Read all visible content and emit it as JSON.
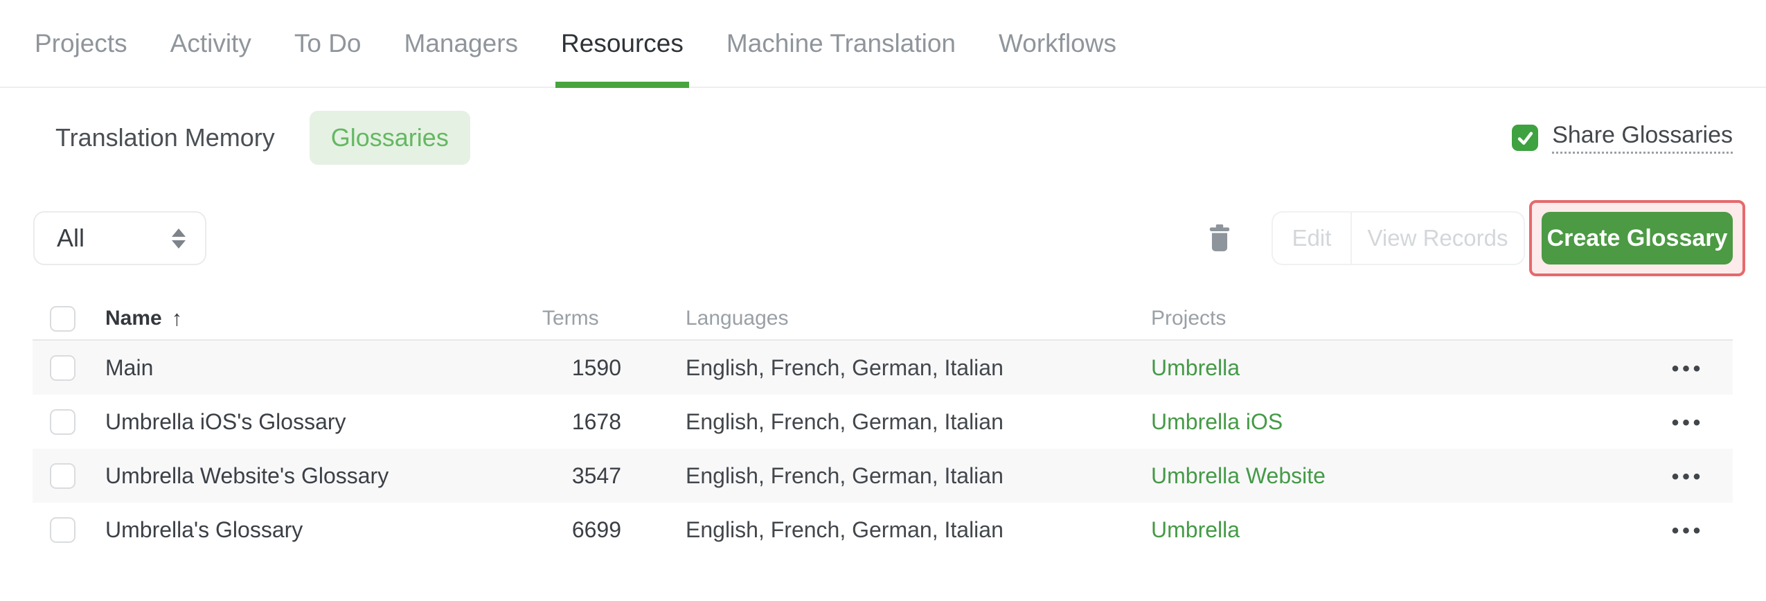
{
  "colors": {
    "accent_green": "#47a43f",
    "button_green": "#4c9a44",
    "link_green": "#449a46",
    "pill_background": "#e5f1e3",
    "pill_text": "#64b862",
    "checkbox_green": "#3da23f",
    "annotation_red": "#e5696c",
    "annotation_fill": "#fcebea"
  },
  "nav": {
    "tabs": [
      {
        "label": "Projects",
        "active": false
      },
      {
        "label": "Activity",
        "active": false
      },
      {
        "label": "To Do",
        "active": false
      },
      {
        "label": "Managers",
        "active": false
      },
      {
        "label": "Resources",
        "active": true
      },
      {
        "label": "Machine Translation",
        "active": false
      },
      {
        "label": "Workflows",
        "active": false
      }
    ]
  },
  "subtabs": {
    "items": [
      {
        "label": "Translation Memory",
        "active": false
      },
      {
        "label": "Glossaries",
        "active": true
      }
    ]
  },
  "share_glossaries": {
    "label": "Share Glossaries",
    "checked": true
  },
  "toolbar": {
    "filter": {
      "value": "All"
    },
    "buttons": {
      "edit": "Edit",
      "view_records": "View Records",
      "create": "Create Glossary"
    }
  },
  "table": {
    "columns": {
      "name": "Name",
      "terms": "Terms",
      "languages": "Languages",
      "projects": "Projects"
    },
    "sort": {
      "column": "Name",
      "direction": "asc",
      "icon": "↑"
    },
    "row_menu_icon": "•••",
    "rows": [
      {
        "name": "Main",
        "terms": "1590",
        "languages": "English, French, German, Italian",
        "project": "Umbrella"
      },
      {
        "name": "Umbrella iOS's Glossary",
        "terms": "1678",
        "languages": "English, French, German, Italian",
        "project": "Umbrella iOS"
      },
      {
        "name": "Umbrella Website's Glossary",
        "terms": "3547",
        "languages": "English, French, German, Italian",
        "project": "Umbrella Website"
      },
      {
        "name": "Umbrella's Glossary",
        "terms": "6699",
        "languages": "English, French, German, Italian",
        "project": "Umbrella"
      }
    ]
  }
}
